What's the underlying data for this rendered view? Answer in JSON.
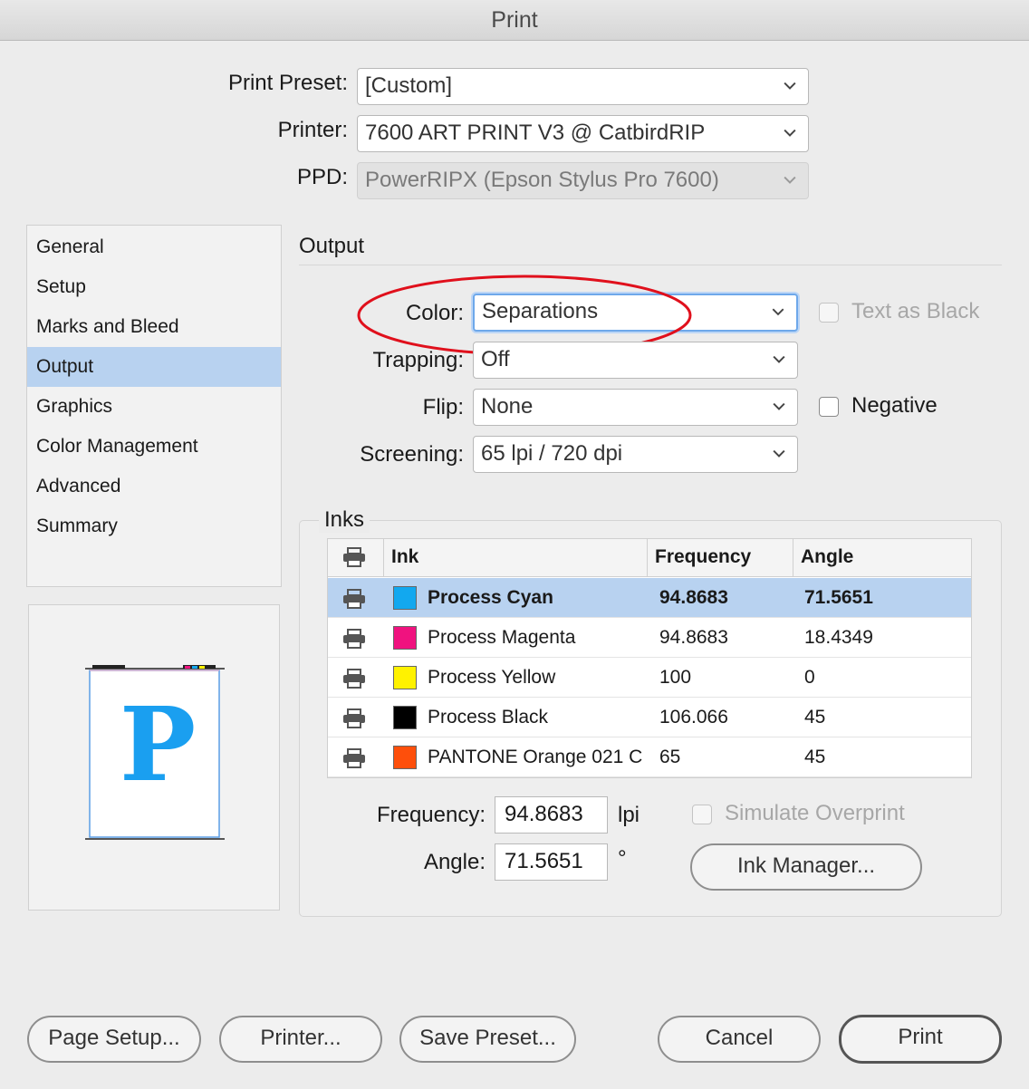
{
  "window": {
    "title": "Print"
  },
  "preset": {
    "label": "Print Preset:",
    "value": "[Custom]"
  },
  "printer": {
    "label": "Printer:",
    "value": "7600 ART PRINT V3 @ CatbirdRIP"
  },
  "ppd": {
    "label": "PPD:",
    "value": "PowerRIPX (Epson Stylus Pro 7600)"
  },
  "sidebar": {
    "items": [
      {
        "label": "General"
      },
      {
        "label": "Setup"
      },
      {
        "label": "Marks and Bleed"
      },
      {
        "label": "Output",
        "selected": true
      },
      {
        "label": "Graphics"
      },
      {
        "label": "Color Management"
      },
      {
        "label": "Advanced"
      },
      {
        "label": "Summary"
      }
    ]
  },
  "preview": {
    "letter": "P",
    "letter_color": "#1a9ff0"
  },
  "output": {
    "heading": "Output",
    "color": {
      "label": "Color:",
      "value": "Separations"
    },
    "text_as_black": {
      "label": "Text as Black",
      "checked": false,
      "enabled": false
    },
    "trapping": {
      "label": "Trapping:",
      "value": "Off"
    },
    "flip": {
      "label": "Flip:",
      "value": "None"
    },
    "negative": {
      "label": "Negative",
      "checked": false
    },
    "screening": {
      "label": "Screening:",
      "value": "65 lpi / 720 dpi"
    },
    "highlight_color": "#e0101c"
  },
  "inks": {
    "heading": "Inks",
    "columns": {
      "ink": "Ink",
      "frequency": "Frequency",
      "angle": "Angle"
    },
    "rows": [
      {
        "name": "Process Cyan",
        "frequency": "94.8683",
        "angle": "71.5651",
        "color": "#12a8ef",
        "selected": true
      },
      {
        "name": "Process Magenta",
        "frequency": "94.8683",
        "angle": "18.4349",
        "color": "#f0127f"
      },
      {
        "name": "Process Yellow",
        "frequency": "100",
        "angle": "0",
        "color": "#fff200"
      },
      {
        "name": "Process Black",
        "frequency": "106.066",
        "angle": "45",
        "color": "#000000"
      },
      {
        "name": "PANTONE Orange 021 C",
        "frequency": "65",
        "angle": "45",
        "color": "#fe4f0b"
      }
    ],
    "frequency": {
      "label": "Frequency:",
      "value": "94.8683",
      "unit": "lpi"
    },
    "angle": {
      "label": "Angle:",
      "value": "71.5651",
      "unit": "°"
    },
    "simulate_overprint": {
      "label": "Simulate Overprint",
      "checked": false,
      "enabled": false
    },
    "ink_manager_label": "Ink Manager..."
  },
  "buttons": {
    "page_setup": "Page Setup...",
    "printer": "Printer...",
    "save_preset": "Save Preset...",
    "cancel": "Cancel",
    "print": "Print"
  }
}
